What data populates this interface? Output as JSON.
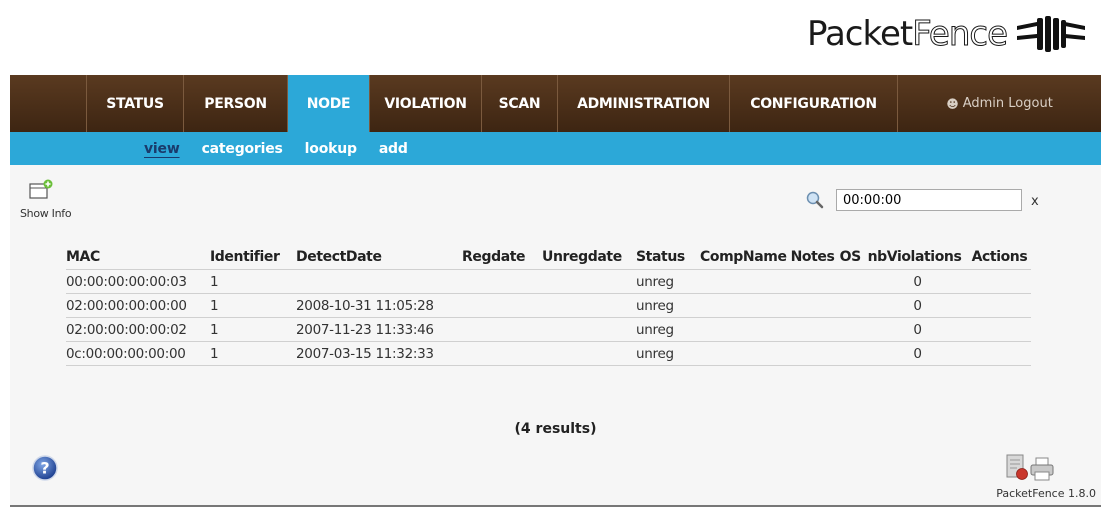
{
  "logo": {
    "text_bold": "Packet",
    "text_light": "Fence"
  },
  "nav": {
    "items": [
      {
        "label": "STATUS",
        "active": false
      },
      {
        "label": "PERSON",
        "active": false
      },
      {
        "label": "NODE",
        "active": true
      },
      {
        "label": "VIOLATION",
        "active": false
      },
      {
        "label": "SCAN",
        "active": false
      },
      {
        "label": "ADMINISTRATION",
        "active": false
      },
      {
        "label": "CONFIGURATION",
        "active": false
      }
    ],
    "admin_logout": "Admin Logout"
  },
  "subnav": {
    "items": [
      {
        "label": "view",
        "active": true
      },
      {
        "label": "categories",
        "active": false
      },
      {
        "label": "lookup",
        "active": false
      },
      {
        "label": "add",
        "active": false
      }
    ]
  },
  "toolbar": {
    "show_info": "Show Info"
  },
  "search": {
    "value": "00:00:00",
    "clear": "x"
  },
  "table": {
    "headers": [
      "MAC",
      "Identifier",
      "DetectDate",
      "Regdate",
      "Unregdate",
      "Status",
      "CompName",
      "Notes",
      "OS",
      "nbViolations",
      "Actions"
    ],
    "rows": [
      [
        "00:00:00:00:00:03",
        "1",
        "",
        "",
        "",
        "unreg",
        "",
        "",
        "",
        "0",
        ""
      ],
      [
        "02:00:00:00:00:00",
        "1",
        "2008-10-31 11:05:28",
        "",
        "",
        "unreg",
        "",
        "",
        "",
        "0",
        ""
      ],
      [
        "02:00:00:00:00:02",
        "1",
        "2007-11-23 11:33:46",
        "",
        "",
        "unreg",
        "",
        "",
        "",
        "0",
        ""
      ],
      [
        "0c:00:00:00:00:00",
        "1",
        "2007-03-15 11:32:33",
        "",
        "",
        "unreg",
        "",
        "",
        "",
        "0",
        ""
      ]
    ]
  },
  "results": "(4 results)",
  "footer": {
    "version": "PacketFence 1.8.0"
  },
  "colors": {
    "nav_brown": "#4a2e18",
    "accent_blue": "#2ca8d8",
    "panel_bg": "#f6f6f6"
  },
  "icons": [
    "show-info-icon",
    "search-icon",
    "help-icon",
    "export-icon",
    "printer-icon",
    "user-icon"
  ]
}
